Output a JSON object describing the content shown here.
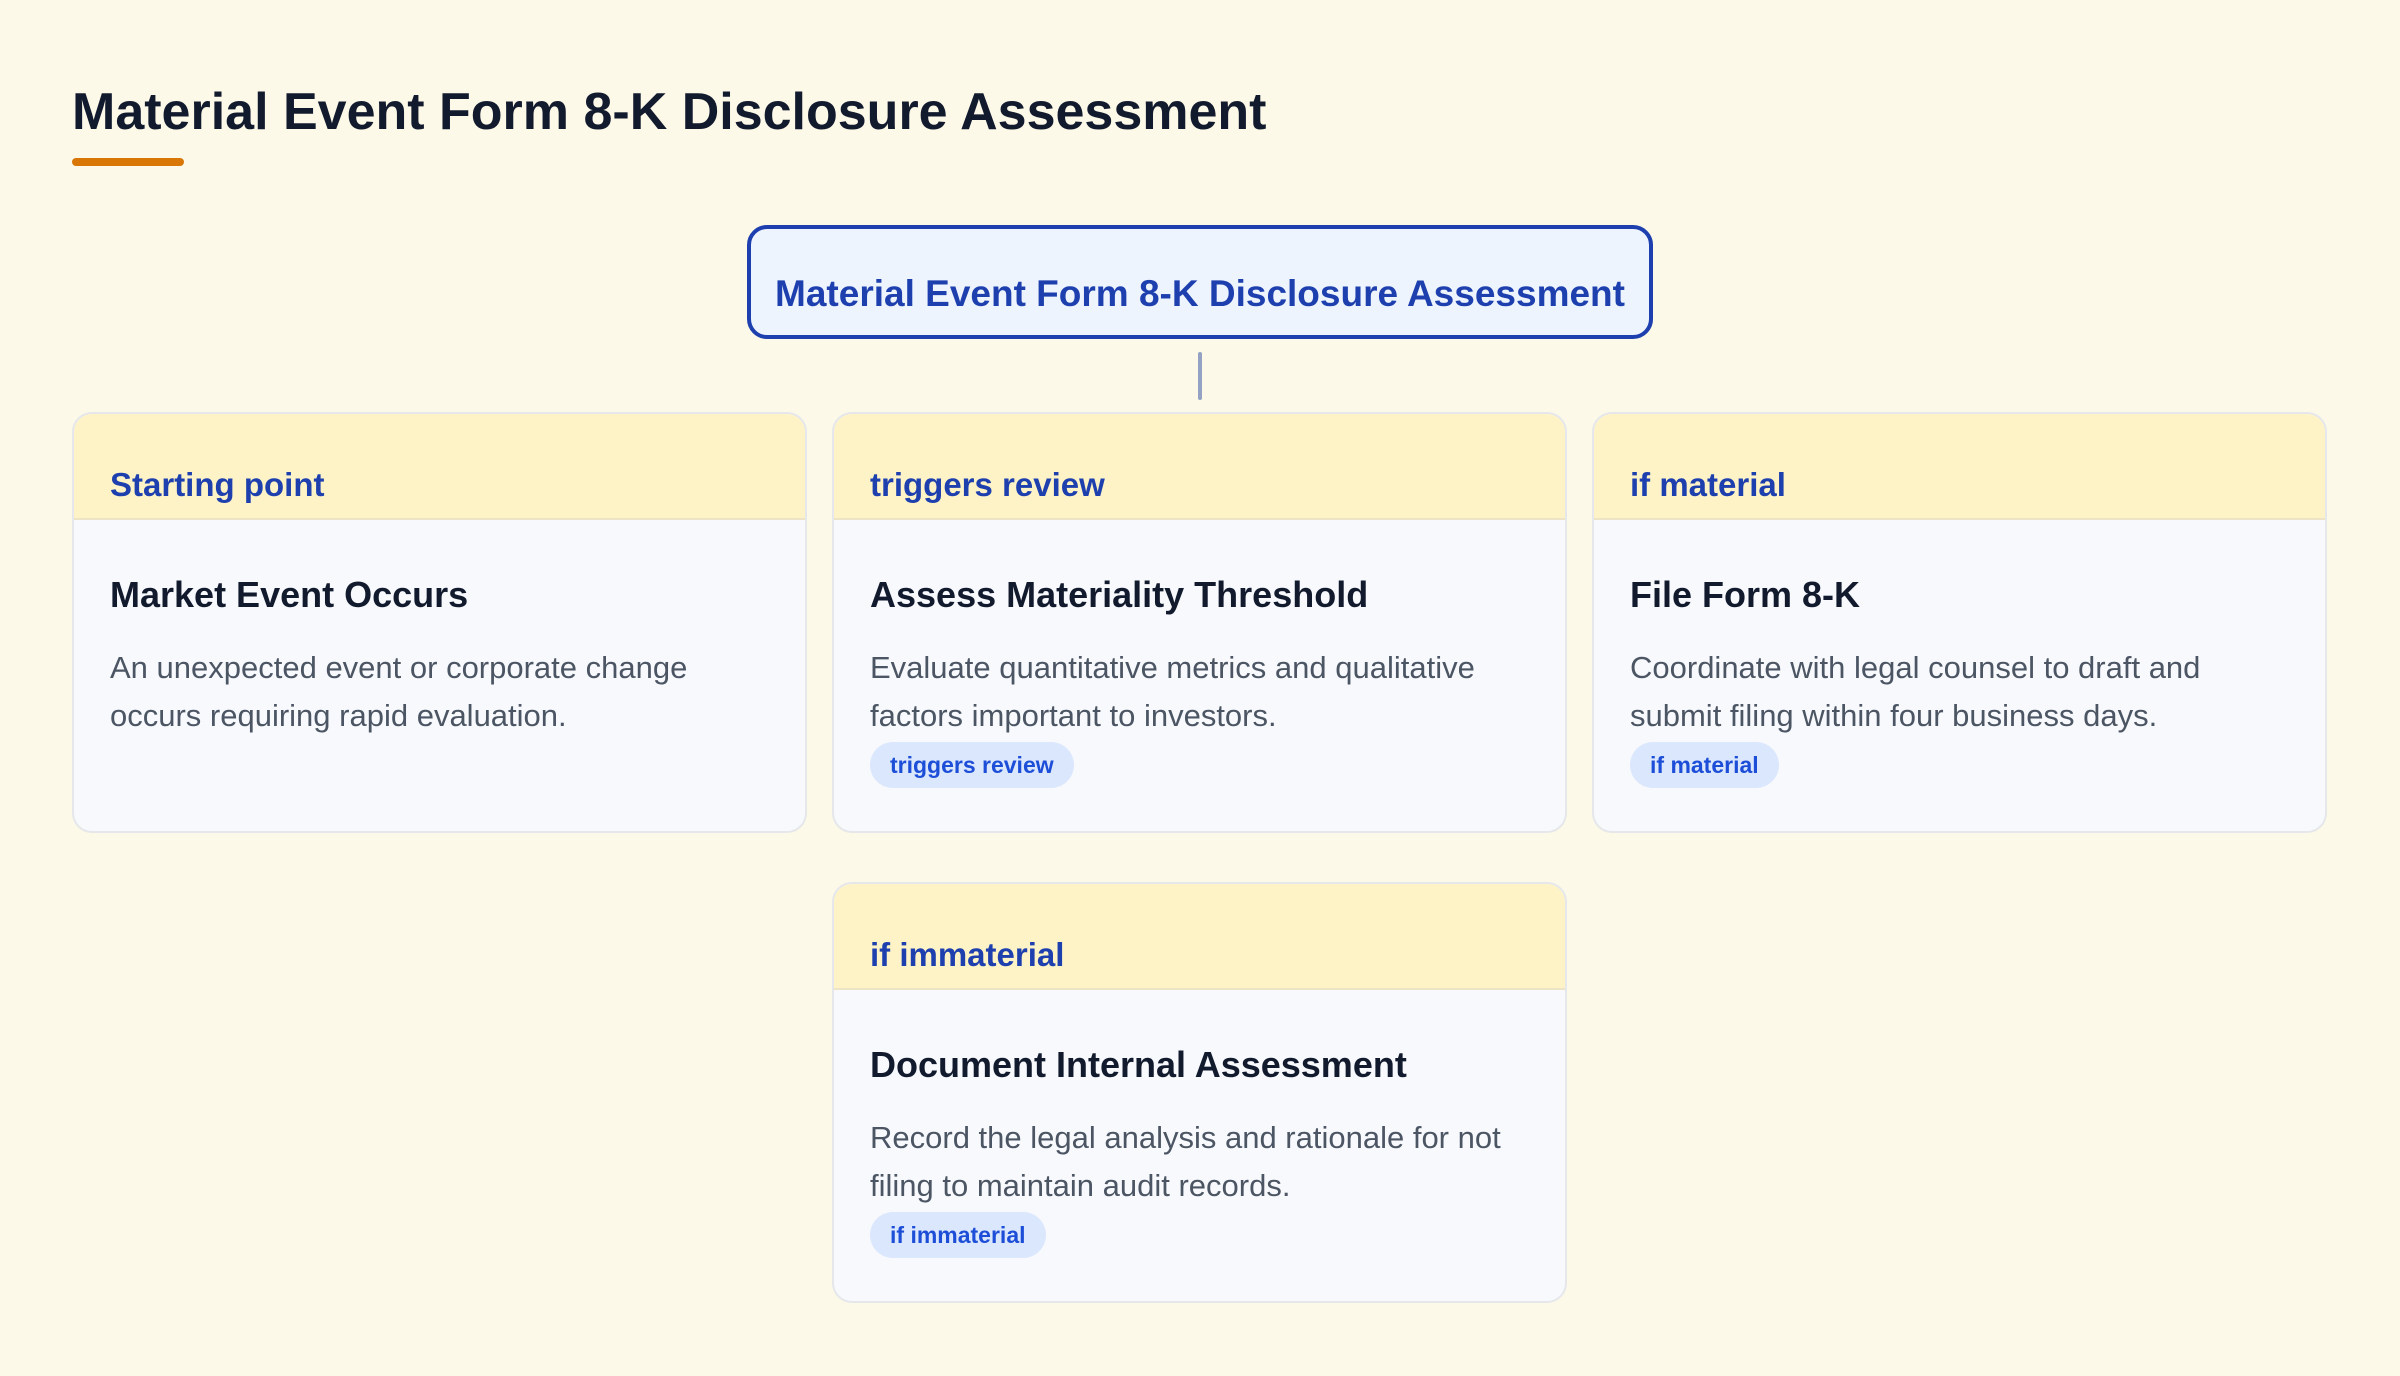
{
  "page_title": "Material Event Form 8-K Disclosure Assessment",
  "colors": {
    "background": "#fdf9e8",
    "accent_underline": "#d97706",
    "root_border": "#1e40af",
    "root_fill": "#eef4fd",
    "card_header": "#fef3c7",
    "card_body": "#f7f9fc",
    "badge_fill": "#dbe7fd",
    "badge_text": "#1d4ed8"
  },
  "root": {
    "label": "Material Event Form 8-K Disclosure Assessment"
  },
  "steps": [
    {
      "tag": "Starting point",
      "title": "Market Event Occurs",
      "description": "An unexpected event or corporate change occurs requiring rapid evaluation.",
      "badge": ""
    },
    {
      "tag": "triggers review",
      "title": "Assess Materiality Threshold",
      "description": "Evaluate quantitative metrics and qualitative factors important to investors.",
      "badge": "triggers review"
    },
    {
      "tag": "if material",
      "title": "File Form 8-K",
      "description": "Coordinate with legal counsel to draft and submit filing within four business days.",
      "badge": "if material"
    },
    {
      "tag": "if immaterial",
      "title": "Document Internal Assessment",
      "description": "Record the legal analysis and rationale for not filing to maintain audit records.",
      "badge": "if immaterial"
    }
  ]
}
